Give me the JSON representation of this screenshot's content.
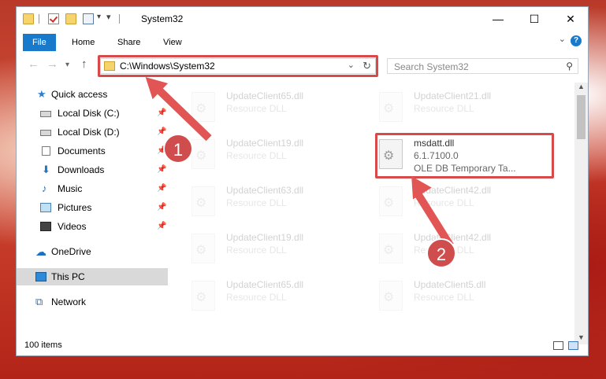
{
  "window": {
    "title": "System32"
  },
  "ribbon": {
    "tabs": [
      "File",
      "Home",
      "Share",
      "View"
    ]
  },
  "address": {
    "path": "C:\\Windows\\System32"
  },
  "search": {
    "placeholder": "Search System32"
  },
  "sidebar": {
    "items": [
      {
        "label": "Quick access",
        "icon": "star-icon"
      },
      {
        "label": "Local Disk (C:)",
        "icon": "disk-icon",
        "pinned": true
      },
      {
        "label": "Local Disk (D:)",
        "icon": "disk-icon",
        "pinned": true
      },
      {
        "label": "Documents",
        "icon": "document-icon",
        "pinned": true
      },
      {
        "label": "Downloads",
        "icon": "download-icon",
        "pinned": true
      },
      {
        "label": "Music",
        "icon": "music-icon",
        "pinned": true
      },
      {
        "label": "Pictures",
        "icon": "pictures-icon",
        "pinned": true
      },
      {
        "label": "Videos",
        "icon": "videos-icon",
        "pinned": true
      },
      {
        "label": "OneDrive",
        "icon": "cloud-icon"
      },
      {
        "label": "This PC",
        "icon": "computer-icon",
        "selected": true
      },
      {
        "label": "Network",
        "icon": "network-icon"
      }
    ]
  },
  "files": [
    {
      "name": "UpdateClient65.dll",
      "desc": "Resource DLL"
    },
    {
      "name": "UpdateClient21.dll",
      "desc": "Resource DLL"
    },
    {
      "name": "UpdateClient19.dll",
      "desc": "Resource DLL"
    },
    {
      "name": "msdatt.dll",
      "version": "6.1.7100.0",
      "desc": "OLE DB Temporary Ta..."
    },
    {
      "name": "UpdateClient63.dll",
      "desc": "Resource DLL"
    },
    {
      "name": "UpdateClient42.dll",
      "desc": "Resource DLL"
    },
    {
      "name": "UpdateClient19.dll",
      "desc": "Resource DLL"
    },
    {
      "name": "UpdateClient42.dll",
      "desc": "Resource DLL"
    },
    {
      "name": "UpdateClient65.dll",
      "desc": "Resource DLL"
    },
    {
      "name": "UpdateClient5.dll",
      "desc": "Resource DLL"
    }
  ],
  "status": {
    "count": "100 items"
  },
  "annotations": {
    "step1": "1",
    "step2": "2"
  },
  "colors": {
    "accent": "#1979ca",
    "annotation": "#d84a4a"
  }
}
